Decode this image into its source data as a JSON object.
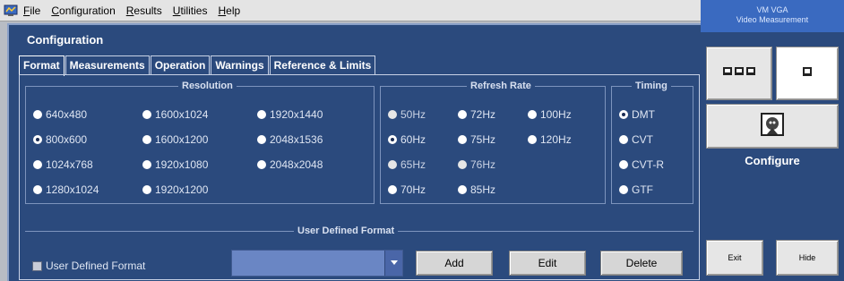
{
  "menu": [
    "File",
    "Configuration",
    "Results",
    "Utilities",
    "Help"
  ],
  "panel_title": "Configuration",
  "tabs": [
    "Format",
    "Measurements",
    "Operation",
    "Warnings",
    "Reference & Limits"
  ],
  "active_tab": "Format",
  "resolution": {
    "title": "Resolution",
    "options": [
      "640x480",
      "1600x1024",
      "1920x1440",
      "800x600",
      "1600x1200",
      "2048x1536",
      "1024x768",
      "1920x1080",
      "2048x2048",
      "1280x1024",
      "1920x1200"
    ],
    "selected": "800x600"
  },
  "refresh_rate": {
    "title": "Refresh Rate",
    "options": [
      "50Hz",
      "72Hz",
      "100Hz",
      "60Hz",
      "75Hz",
      "120Hz",
      "65Hz",
      "76Hz",
      "70Hz",
      "85Hz"
    ],
    "selected": "60Hz"
  },
  "timing": {
    "title": "Timing",
    "options": [
      "DMT",
      "CVT",
      "CVT-R",
      "GTF"
    ],
    "selected": "DMT"
  },
  "user_defined": {
    "title": "User Defined Format",
    "checkbox_label": "User Defined Format",
    "checked": false,
    "combo_value": "",
    "add_label": "Add",
    "edit_label": "Edit",
    "delete_label": "Delete"
  },
  "side": {
    "title_line1": "VM VGA",
    "title_line2": "Video Measurement",
    "configure_label": "Configure",
    "exit_label": "Exit",
    "hide_label": "Hide"
  },
  "colors": {
    "panel_bg": "#2b4a7d",
    "side_header": "#3a6ac0",
    "combo_bg": "#6a86c4"
  }
}
